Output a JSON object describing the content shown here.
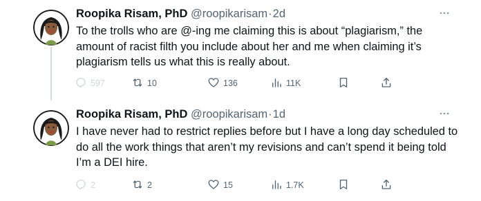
{
  "tweets": [
    {
      "author_name": "Roopika Risam, PhD",
      "handle": "@roopikarisam",
      "separator": "·",
      "time": "2d",
      "text": "To the trolls who are @-ing me claiming this is about “plagiarism,” the amount of racist filth you include about her and me when claiming it’s plagiarism tells us what this is really about.",
      "actions": {
        "replies": "597",
        "retweets": "10",
        "likes": "136",
        "views": "11K"
      }
    },
    {
      "author_name": "Roopika Risam, PhD",
      "handle": "@roopikarisam",
      "separator": "·",
      "time": "1d",
      "text": "I have never had to restrict replies before but I have a long day scheduled to do all the work things that aren’t my revisions and can’t spend it being told I’m a DEI hire.",
      "actions": {
        "replies": "2",
        "retweets": "2",
        "likes": "15",
        "views": "1.7K"
      }
    }
  ],
  "icons": [
    "reply-icon",
    "retweet-icon",
    "like-icon",
    "views-icon",
    "bookmark-icon",
    "share-icon",
    "more-icon"
  ],
  "colors": {
    "text": "#0f1419",
    "secondary": "#536471",
    "thread_line": "#cfd9de",
    "disabled": "#d0d7dc"
  }
}
